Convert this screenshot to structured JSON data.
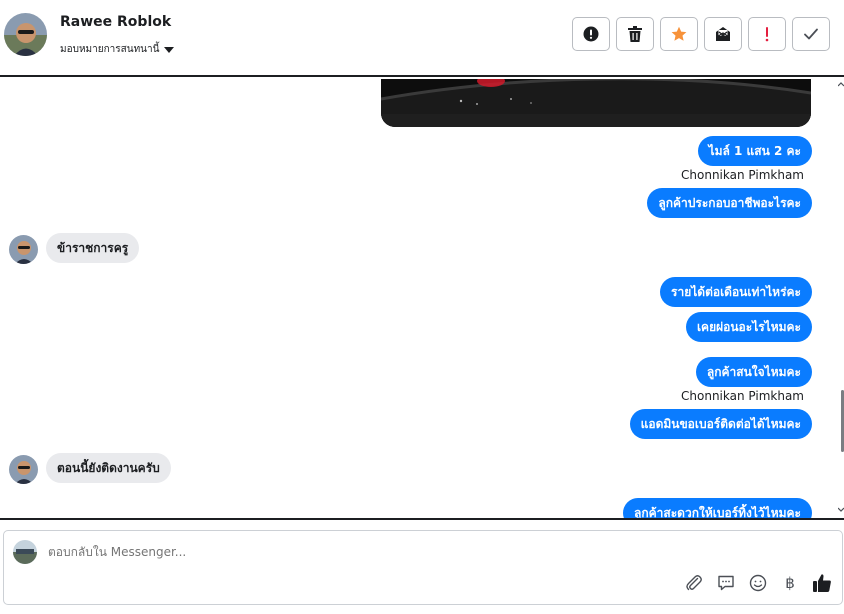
{
  "header": {
    "user_name": "Rawee Roblok",
    "assign_label": "มอบหมายการสนทนานี้",
    "actions": [
      {
        "icon": "alert-circle-icon"
      },
      {
        "icon": "trash-icon"
      },
      {
        "icon": "star-icon"
      },
      {
        "icon": "archive-inbox-icon"
      },
      {
        "icon": "exclamation-icon"
      },
      {
        "icon": "checkmark-icon"
      }
    ]
  },
  "messages": [
    {
      "type": "image",
      "direction": "outgoing"
    },
    {
      "type": "text",
      "direction": "outgoing",
      "text": "ไมล์ 1 แสน 2 คะ"
    },
    {
      "type": "sender",
      "text": "Chonnikan Pimkham"
    },
    {
      "type": "text",
      "direction": "outgoing",
      "text": "ลูกค้าประกอบอาชีพอะไรคะ"
    },
    {
      "type": "text",
      "direction": "incoming",
      "text": "ข้าราชการครู"
    },
    {
      "type": "text",
      "direction": "outgoing",
      "text": "รายได้ต่อเดือนเท่าไหร่คะ"
    },
    {
      "type": "text",
      "direction": "outgoing",
      "text": "เคยผ่อนอะไรไหมคะ"
    },
    {
      "type": "text",
      "direction": "outgoing",
      "text": "ลูกค้าสนใจไหมคะ"
    },
    {
      "type": "sender",
      "text": "Chonnikan Pimkham"
    },
    {
      "type": "text",
      "direction": "outgoing",
      "text": "แอดมินขอเบอร์ติดต่อได้ไหมคะ"
    },
    {
      "type": "text",
      "direction": "incoming",
      "text": "ตอนนี้ยังติดงานครับ"
    },
    {
      "type": "text",
      "direction": "outgoing",
      "text": "ลูกค้าสะดวกให้เบอร์ทิ้งไว้ไหมคะ"
    }
  ],
  "composer": {
    "placeholder": "ตอบกลับใน Messenger...",
    "tools": [
      "paperclip-icon",
      "speech-bubble-icon",
      "emoji-icon",
      "baht-icon",
      "thumbs-up-icon"
    ],
    "baht_symbol": "฿"
  },
  "colors": {
    "outgoing_bubble": "#0a7cff",
    "incoming_bubble": "#e9eaed",
    "star": "#f7923a",
    "alert": "#e41e3f"
  }
}
